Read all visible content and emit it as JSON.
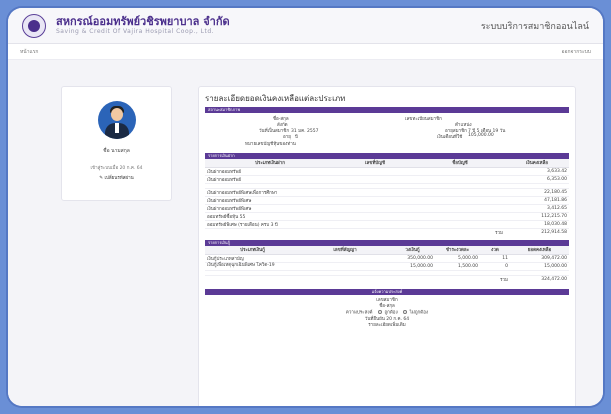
{
  "header": {
    "brand_th": "สหกรณ์ออมทรัพย์วชิรพยาบาล จำกัด",
    "brand_en": "Saving & Credit Of Vajira Hospital Coop., Ltd.",
    "system_title": "ระบบบริการสมาชิกออนไลน์"
  },
  "nav": {
    "home": "หน้าแรก",
    "logout": "ออกจากระบบ"
  },
  "profile": {
    "name": "ชื่อ นามสกุล",
    "login_date": "เข้าสู่ระบบเมื่อ 20 ก.ค. 64",
    "change_password": "✎ เปลี่ยนรหัสผ่าน"
  },
  "report": {
    "title": "รายละเอียดยอดเงินคงเหลือแต่ละประเภท",
    "member_section": "สถานะสมาชิกภาพ",
    "member_info": {
      "name_label": "ชื่อ-สกุล",
      "affiliation_label": "สังกัด",
      "join_date_label": "วันที่เป็นสมาชิก",
      "join_date_value": "31 มค. 2557",
      "age_label": "อายุ",
      "age_value": "ปี",
      "account_label": "หมายเลขบัญชีหุ้นของท่าน",
      "member_no_label": "เลขทะเบียนสมาชิก",
      "position_label": "ตำแหน่ง",
      "membership_years_label": "อายุสมาชิก",
      "membership_years_value": "7 ปี 5 เดือน 19 วัน",
      "salary_label": "เงินเดือนที่ใช้",
      "salary_value": "105,000.00"
    }
  },
  "deposits": {
    "section": "รายการเงินฝาก",
    "headers": [
      "ประเภทเงินฝาก",
      "เลขที่บัญชี",
      "ชื่อบัญชี",
      "เงินคงเหลือ"
    ],
    "rows": [
      {
        "type": "เงินฝากออมทรัพย์",
        "account": "",
        "name": "",
        "balance": "3,633.42"
      },
      {
        "type": "เงินฝากออมทรัพย์",
        "account": "",
        "name": "",
        "balance": "6,353.00"
      },
      {
        "type": "เงินฝากออมทรัพย์พิเศษเพื่อการศึกษา",
        "account": "",
        "name": "",
        "balance": "22,180.45"
      },
      {
        "type": "เงินฝากออมทรัพย์พิเศษ",
        "account": "",
        "name": "",
        "balance": "47,181.86"
      },
      {
        "type": "เงินฝากออมทรัพย์พิเศษ",
        "account": "",
        "name": "",
        "balance": "3,412.65"
      },
      {
        "type": "ออมทรัพย์ซื้อหุ้น 55",
        "account": "",
        "name": "",
        "balance": "112,215.70"
      },
      {
        "type": "ออมทรัพย์พิเศษ (รายเดือน) ครบ 3 ปี",
        "account": "",
        "name": "",
        "balance": "18,030.48"
      }
    ],
    "total_label": "รวม",
    "total_value": "212,914.58"
  },
  "loans": {
    "section": "รายการเงินกู้",
    "headers": [
      "ประเภทเงินกู้",
      "เลขที่สัญญา",
      "วงเงินกู้",
      "ชำระงวดละ",
      "งวด",
      "ยอดคงเหลือ"
    ],
    "rows": [
      {
        "type": "เงินกู้ประเภทสามัญ",
        "contract": "",
        "limit": "350,000.00",
        "installment": "5,000.00",
        "period": "11",
        "balance": "309,472.00"
      },
      {
        "type": "เงินกู้เพื่อเหตุฉุกเฉินพิเศษ โควิด-19",
        "contract": "",
        "limit": "15,000.00",
        "installment": "1,500.00",
        "period": "0",
        "balance": "15,000.00"
      }
    ],
    "total_label": "รวม",
    "total_value": "324,472.00"
  },
  "request": {
    "section": "แจ้งความประสงค์",
    "member_no_label": "เลขสมาชิก",
    "name_label": "ชื่อ-สกุล",
    "wish_label": "ความประสงค์",
    "option_yes": "ถูกต้อง",
    "option_no": "ไม่ถูกต้อง",
    "date_label": "วันที่ยืนยัน",
    "date_value": "20 ก.ค. 64",
    "more_label": "รายละเอียดเพิ่มเติม"
  }
}
